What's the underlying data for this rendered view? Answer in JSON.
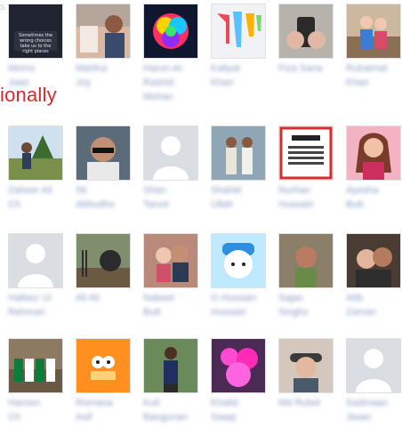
{
  "page": {
    "top_fragment": "s",
    "overlay_text": "ionally"
  },
  "colors": {
    "link_blue": "#8b9dc3",
    "placeholder_bg": "#dadde1",
    "overlay_red": "#e0252c"
  },
  "friends": [
    {
      "line1": "Momo",
      "line2": "Jaan",
      "photo_icon": "quote-image-icon"
    },
    {
      "line1": "Mahfuz",
      "line2": "Joy",
      "photo_icon": "person-photo-icon"
    },
    {
      "line1": "Harun-Ar",
      "line2": "Rashid",
      "line3": "Mohan",
      "photo_icon": "rainbow-rose-icon"
    },
    {
      "line1": "Kaliyat",
      "line2": "Khan",
      "photo_icon": "paint-drips-icon"
    },
    {
      "line1": "Fiza Sana",
      "line2": "",
      "photo_icon": "hands-phone-icon"
    },
    {
      "line1": "Ruhaimal",
      "line2": "Khan",
      "photo_icon": "two-kids-icon"
    },
    {
      "line1": "Zaheer Ali",
      "line2": "Ch",
      "photo_icon": "person-outdoor-icon"
    },
    {
      "line1": "Sk",
      "line2": "Abhudho",
      "photo_icon": "sunglasses-man-icon"
    },
    {
      "line1": "Shan",
      "line2": "Tanvir",
      "photo_icon": "default-avatar-icon"
    },
    {
      "line1": "Shahid",
      "line2": "Ullah",
      "photo_icon": "two-men-icon"
    },
    {
      "line1": "Nurhan",
      "line2": "Hussain",
      "photo_icon": "urdu-text-image-icon"
    },
    {
      "line1": "Ayesha",
      "line2": "Butt",
      "photo_icon": "woman-portrait-icon"
    },
    {
      "line1": "Hafeez Ur",
      "line2": "Rehman",
      "photo_icon": "default-avatar-icon"
    },
    {
      "line1": "Ali Ali",
      "line2": "",
      "photo_icon": "bear-photo-icon"
    },
    {
      "line1": "Nabeel",
      "line2": "Butt",
      "photo_icon": "couple-photo-icon"
    },
    {
      "line1": "G Hussain",
      "line2": "Hussain",
      "photo_icon": "cat-hat-icon"
    },
    {
      "line1": "Sajan",
      "line2": "Singhz",
      "photo_icon": "man-selfie-icon"
    },
    {
      "line1": "Atib",
      "line2": "Zaman",
      "photo_icon": "couple-selfie-icon"
    },
    {
      "line1": "Haroon",
      "line2": "Ch",
      "photo_icon": "group-photo-icon"
    },
    {
      "line1": "Romana",
      "line2": "Asif",
      "photo_icon": "cartoon-character-icon"
    },
    {
      "line1": "Kuli",
      "line2": "Bangunan",
      "photo_icon": "man-standing-icon"
    },
    {
      "line1": "Khalid",
      "line2": "Saaqi",
      "photo_icon": "pink-flower-icon"
    },
    {
      "line1": "Md Rubel",
      "line2": "",
      "photo_icon": "hat-person-icon"
    },
    {
      "line1": "Sadmaan",
      "line2": "Jiwan",
      "photo_icon": "default-avatar-icon"
    }
  ]
}
